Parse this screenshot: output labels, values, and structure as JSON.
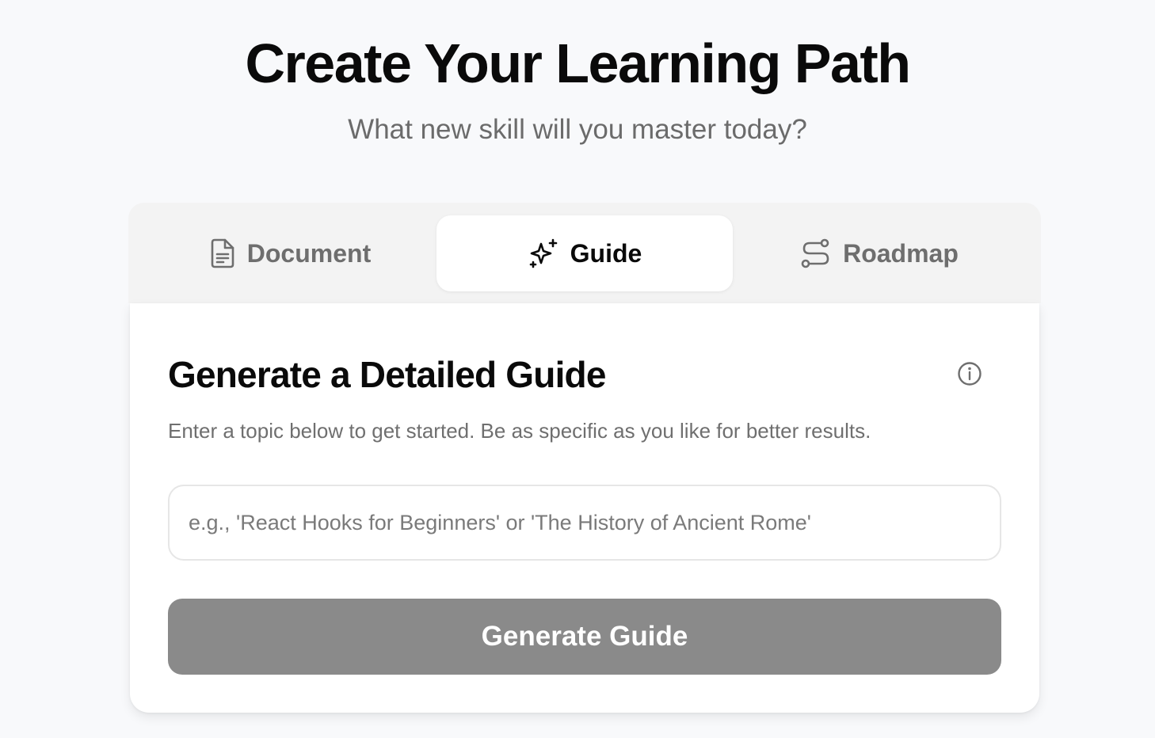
{
  "header": {
    "title": "Create Your Learning Path",
    "subtitle": "What new skill will you master today?"
  },
  "tabs": [
    {
      "label": "Document",
      "icon": "document-icon",
      "selected": false
    },
    {
      "label": "Guide",
      "icon": "sparkles-icon",
      "selected": true
    },
    {
      "label": "Roadmap",
      "icon": "route-icon",
      "selected": false
    }
  ],
  "card": {
    "title": "Generate a Detailed Guide",
    "description": "Enter a topic below to get started. Be as specific as you like for better results.",
    "info_icon": "info-icon",
    "input": {
      "value": "",
      "placeholder": "e.g., 'React Hooks for Beginners' or 'The History of Ancient Rome'"
    },
    "submit_label": "Generate Guide"
  },
  "colors": {
    "background": "#f8f9fb",
    "tab_bar": "#f3f3f3",
    "active_tab": "#ffffff",
    "button_disabled": "#8a8a8a",
    "muted_text": "#6f6f6f"
  }
}
